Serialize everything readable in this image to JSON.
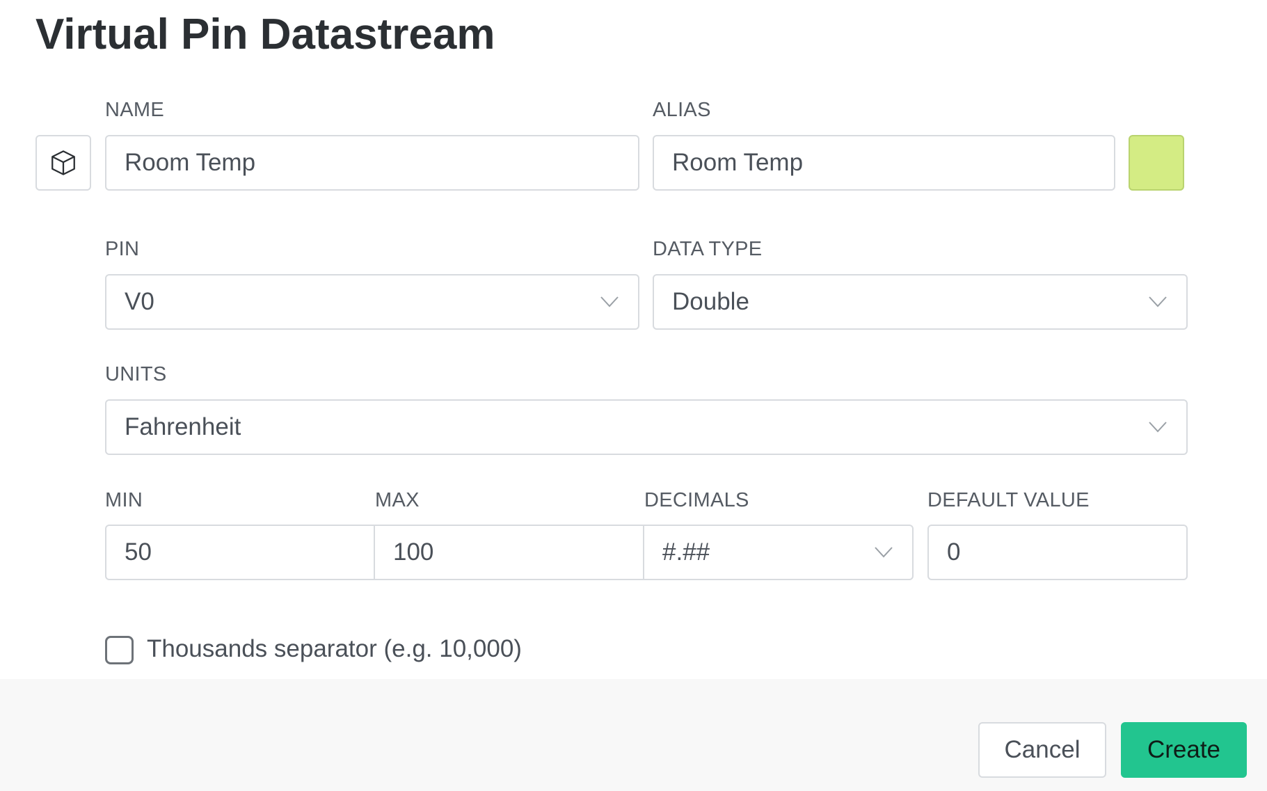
{
  "dialog": {
    "title": "Virtual Pin Datastream"
  },
  "name_field": {
    "label": "NAME",
    "value": "Room Temp",
    "icon": "cube-icon"
  },
  "alias_field": {
    "label": "ALIAS",
    "value": "Room Temp",
    "color": "#d4ec84"
  },
  "pin_field": {
    "label": "PIN",
    "value": "V0"
  },
  "data_type_field": {
    "label": "DATA TYPE",
    "value": "Double"
  },
  "units_field": {
    "label": "UNITS",
    "value": "Fahrenheit"
  },
  "min_field": {
    "label": "MIN",
    "value": "50"
  },
  "max_field": {
    "label": "MAX",
    "value": "100"
  },
  "decimals_field": {
    "label": "DECIMALS",
    "value": "#.##"
  },
  "default_value_field": {
    "label": "DEFAULT VALUE",
    "value": "0"
  },
  "thousands_separator": {
    "label": "Thousands separator (e.g. 10,000)",
    "checked": false
  },
  "footer": {
    "cancel_label": "Cancel",
    "create_label": "Create",
    "accent_color": "#22c58f"
  }
}
